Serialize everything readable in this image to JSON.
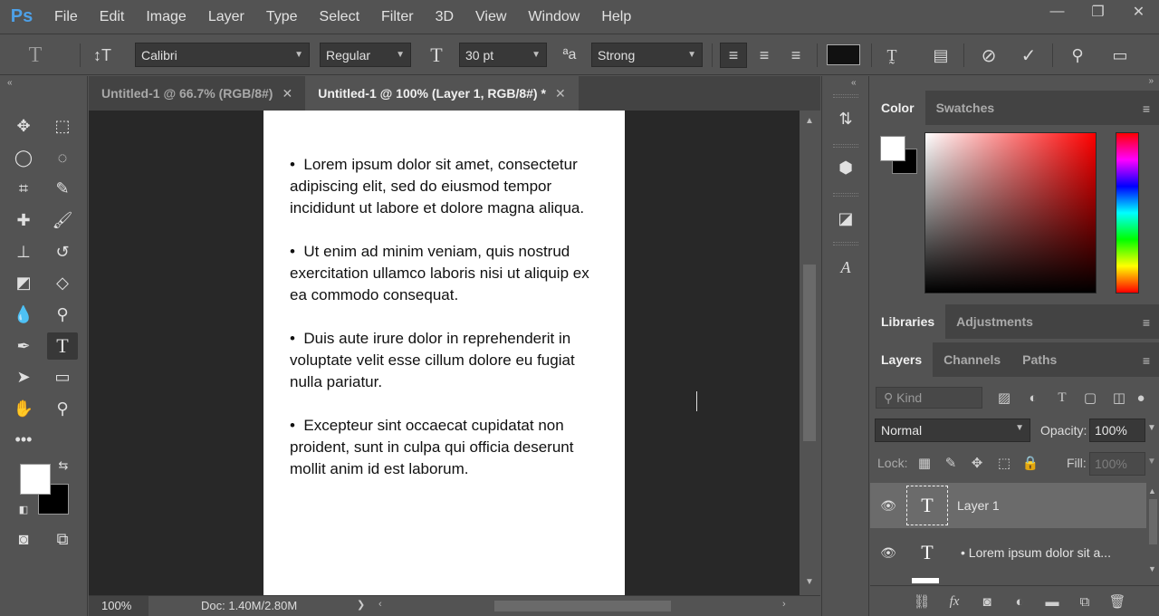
{
  "app": {
    "logo": "Ps"
  },
  "menu": [
    "File",
    "Edit",
    "Image",
    "Layer",
    "Type",
    "Select",
    "Filter",
    "3D",
    "View",
    "Window",
    "Help"
  ],
  "window_controls": {
    "minimize": "—",
    "restore": "❐",
    "close": "✕"
  },
  "options": {
    "font_family": "Calibri",
    "font_style": "Regular",
    "font_size": "30 pt",
    "aa_label": "ªa",
    "antialias": "Strong",
    "text_color": "#111111"
  },
  "tabs": [
    {
      "label": "Untitled-1 @ 66.7% (RGB/8#)",
      "close": "✕",
      "active": false
    },
    {
      "label": "Untitled-1 @ 100% (Layer 1, RGB/8#) *",
      "close": "✕",
      "active": true
    }
  ],
  "document": {
    "bullets": [
      "Lorem ipsum dolor sit amet, consectetur adipiscing elit, sed do eiusmod tempor incididunt ut labore et dolore magna aliqua.",
      "Ut enim ad minim veniam, quis nostrud exercitation ullamco laboris nisi ut aliquip ex ea commodo consequat.",
      "Duis aute irure dolor in reprehenderit in voluptate velit esse cillum dolore eu fugiat nulla pariatur.",
      "Excepteur sint occaecat cupidatat non proident, sunt in culpa qui officia deserunt mollit anim id est laborum."
    ]
  },
  "status": {
    "zoom": "100%",
    "doc_size": "Doc: 1.40M/2.80M",
    "arrow": "❯"
  },
  "panels": {
    "color_tabs": [
      "Color",
      "Swatches"
    ],
    "lib_tabs": [
      "Libraries",
      "Adjustments"
    ],
    "layer_tabs": [
      "Layers",
      "Channels",
      "Paths"
    ],
    "kind_placeholder": "Kind",
    "blend_mode": "Normal",
    "opacity_label": "Opacity:",
    "opacity_value": "100%",
    "lock_label": "Lock:",
    "fill_label": "Fill:",
    "fill_value": "100%"
  },
  "layers": [
    {
      "name": "Layer 1",
      "selected": true
    },
    {
      "name": "• Lorem ipsum dolor sit a...",
      "selected": false
    }
  ]
}
